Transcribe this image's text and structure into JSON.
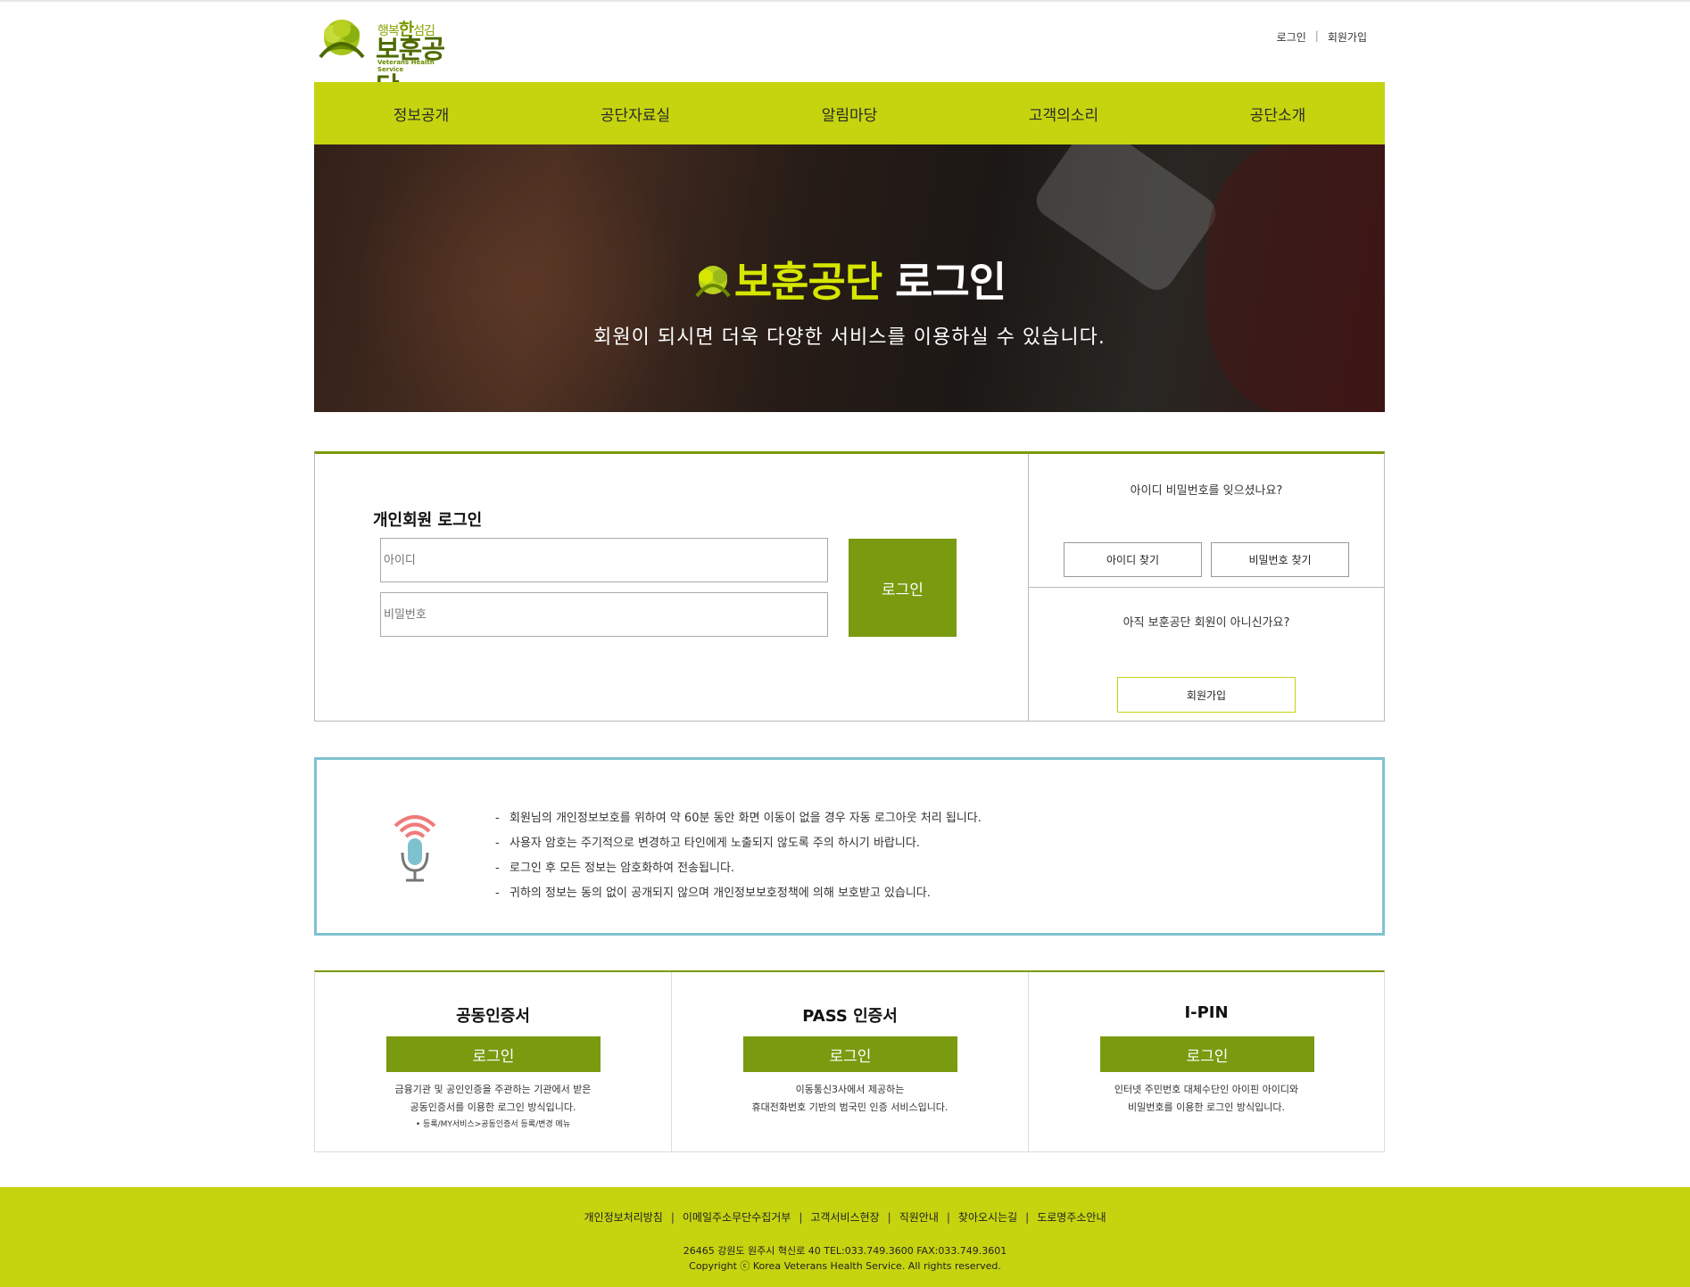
{
  "header": {
    "logo_small_prefix": "행복",
    "logo_small_highlight": "한",
    "logo_small_suffix": "섬김",
    "logo_big": "보훈공단",
    "logo_eng": "Veterans Health Service",
    "util_login": "로그인",
    "util_sep": "|",
    "util_join": "회원가입"
  },
  "nav": [
    "정보공개",
    "공단자료실",
    "알림마당",
    "고객의소리",
    "공단소개"
  ],
  "banner": {
    "brand": "보훈공단",
    "title": "로그인",
    "subtitle": "회원이 되시면 더욱 다양한 서비스를 이용하실 수 있습니다."
  },
  "login": {
    "title": "개인회원 로그인",
    "id_placeholder": "아이디",
    "pw_placeholder": "비밀번호",
    "button": "로그인",
    "forgot_question": "아이디 비밀번호를 잊으셨나요?",
    "find_id": "아이디 찾기",
    "find_pw": "비밀번호 찾기",
    "not_member_question": "아직 보훈공단 회원이 아니신가요?",
    "join": "회원가입"
  },
  "notice": {
    "items": [
      "회원님의 개인정보보호를 위하여 약 60분 동안 화면 이동이 없을 경우 자동 로그아웃 처리 됩니다.",
      "사용자 암호는 주기적으로 변경하고 타인에게 노출되지 않도록 주의 하시기 바랍니다.",
      "로그인 후 모든 정보는 암호화하여 전송됩니다.",
      "귀하의 정보는 동의 없이 공개되지 않으며 개인정보보호정책에 의해 보호받고 있습니다."
    ],
    "dash": "-"
  },
  "certs": [
    {
      "title": "공동인증서",
      "button": "로그인",
      "desc1": "금융기관 및 공인인증을 주관하는 기관에서 받은",
      "desc2": "공동인증서를 이용한 로그인 방식입니다.",
      "note": "• 등록/MY서비스>공동인증서 등록/변경 메뉴"
    },
    {
      "title": "PASS 인증서",
      "button": "로그인",
      "desc1": "이동통신3사에서 제공하는",
      "desc2": "휴대전화번호 기반의 범국민 인증 서비스입니다."
    },
    {
      "title": "I-PIN",
      "button": "로그인",
      "desc1": "인터넷 주민번호 대체수단인 아이핀 아이디와",
      "desc2": "비밀번호를 이용한 로그인 방식입니다."
    }
  ],
  "footer": {
    "links": [
      "개인정보처리방침",
      "이메일주소무단수집거부",
      "고객서비스현장",
      "직원안내",
      "찾아오시는길",
      "도로명주소안내"
    ],
    "link_sep": "|",
    "address": "26465 강원도 원주시 혁신로 40 TEL:033.749.3600 FAX:033.749.3601",
    "copyright": "Copyright ⓒ Korea Veterans Health Service. All rights reserved."
  },
  "colors": {
    "nav_bg": "#c6d410",
    "primary_green": "#7a9a10",
    "notice_border": "#7fc2cf",
    "footer_bg": "#c6d410"
  }
}
